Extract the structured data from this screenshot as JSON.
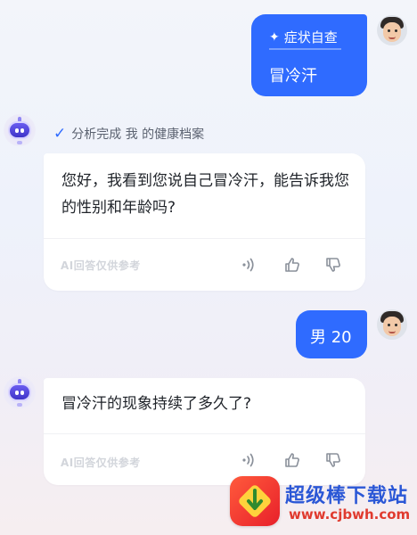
{
  "messages": [
    {
      "role": "user",
      "tag": "症状自查",
      "text": "冒冷汗"
    },
    {
      "role": "assistant",
      "status": "分析完成 我 的健康档案",
      "text": "您好，我看到您说自己冒冷汗，能告诉我您的性别和年龄吗?",
      "footer_note": "AI回答仅供参考"
    },
    {
      "role": "user",
      "text": "男 20"
    },
    {
      "role": "assistant",
      "text": "冒冷汗的现象持续了多久了?",
      "footer_note": "AI回答仅供参考"
    }
  ],
  "actions": [
    "speaker-icon",
    "thumbs-up-icon",
    "thumbs-down-icon"
  ],
  "watermark": {
    "title": "超级棒下载站",
    "url": "www.cjbwh.com"
  },
  "colors": {
    "accent": "#2f6bff",
    "card": "#ffffff",
    "muted": "#5b6270"
  }
}
